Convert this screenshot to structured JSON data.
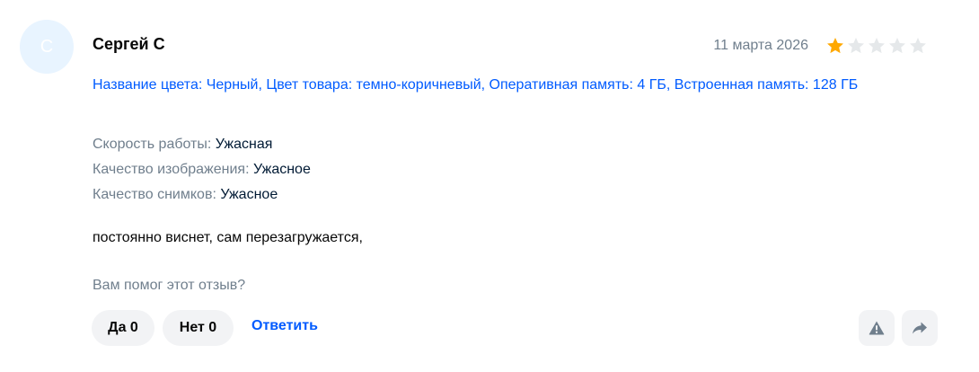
{
  "review": {
    "avatar_letter": "С",
    "author": "Сергей С",
    "date": "11 марта 2026",
    "rating": 1,
    "rating_max": 5,
    "variant_info": "Название цвета: Черный, Цвет товара: темно-коричневый, Оперативная память: 4 ГБ, Встроенная память: 128 ГБ",
    "properties": [
      {
        "key": "Скорость работы: ",
        "value": "Ужасная"
      },
      {
        "key": "Качество изображения: ",
        "value": "Ужасное"
      },
      {
        "key": "Качество снимков: ",
        "value": "Ужасное"
      }
    ],
    "comment": "постоянно виснет, сам перезагружается,",
    "helpful_question": "Вам помог этот отзыв?",
    "yes_label": "Да 0",
    "no_label": "Нет 0",
    "reply_label": "Ответить",
    "icons": {
      "report": "warning-icon",
      "share": "share-arrow-icon"
    }
  },
  "colors": {
    "accent": "#005bff",
    "star_filled": "#ffa800",
    "star_empty": "#e5e8ea",
    "muted_text": "#707f8d",
    "button_bg": "#f2f3f5",
    "avatar_bg": "#e8f4ff"
  }
}
